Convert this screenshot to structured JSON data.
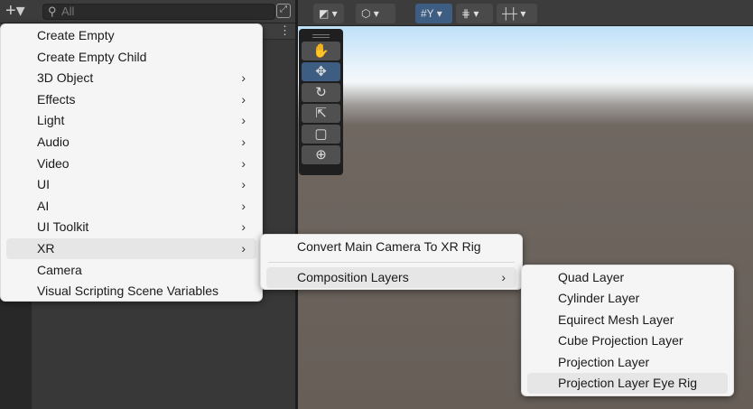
{
  "hierarchy": {
    "add_button": "+▾",
    "search_placeholder": "All",
    "kebab": "⋮"
  },
  "toolbar": {
    "buttons": [
      {
        "icon": "draw-mode-icon",
        "label": "◩ ▾"
      },
      {
        "icon": "gizmo-cube-icon",
        "label": "⬡ ▾"
      },
      {
        "icon": "grid-snap-icon",
        "label": "#Y ▾"
      },
      {
        "icon": "snap-increment-icon",
        "label": "⋕ ▾"
      },
      {
        "icon": "ruler-icon",
        "label": "┼┼ ▾"
      }
    ]
  },
  "tools": [
    {
      "name": "hand-tool",
      "glyph": "✋"
    },
    {
      "name": "move-tool",
      "glyph": "✥",
      "selected": true
    },
    {
      "name": "rotate-tool",
      "glyph": "↻"
    },
    {
      "name": "scale-tool",
      "glyph": "⇱"
    },
    {
      "name": "rect-tool",
      "glyph": "▢"
    },
    {
      "name": "transform-tool",
      "glyph": "⊕"
    }
  ],
  "menu": {
    "items": [
      {
        "label": "Create Empty",
        "arrow": ""
      },
      {
        "label": "Create Empty Child",
        "arrow": ""
      },
      {
        "label": "3D Object",
        "arrow": "›"
      },
      {
        "label": "Effects",
        "arrow": "›"
      },
      {
        "label": "Light",
        "arrow": "›"
      },
      {
        "label": "Audio",
        "arrow": "›"
      },
      {
        "label": "Video",
        "arrow": "›"
      },
      {
        "label": "UI",
        "arrow": "›"
      },
      {
        "label": "AI",
        "arrow": "›"
      },
      {
        "label": "UI Toolkit",
        "arrow": "›"
      },
      {
        "label": "XR",
        "arrow": "›",
        "highlighted": true
      },
      {
        "label": "Camera",
        "arrow": ""
      },
      {
        "label": "Visual Scripting Scene Variables",
        "arrow": ""
      }
    ]
  },
  "xr_menu": {
    "items": [
      {
        "label": "Convert Main Camera To XR Rig",
        "arrow": ""
      },
      {
        "label": "Composition Layers",
        "arrow": "›",
        "highlighted": true
      }
    ]
  },
  "layers_menu": {
    "items": [
      {
        "label": "Quad Layer"
      },
      {
        "label": "Cylinder Layer"
      },
      {
        "label": "Equirect Mesh Layer"
      },
      {
        "label": "Cube Projection Layer"
      },
      {
        "label": "Projection Layer"
      },
      {
        "label": "Projection Layer Eye Rig",
        "highlighted": true
      }
    ]
  }
}
